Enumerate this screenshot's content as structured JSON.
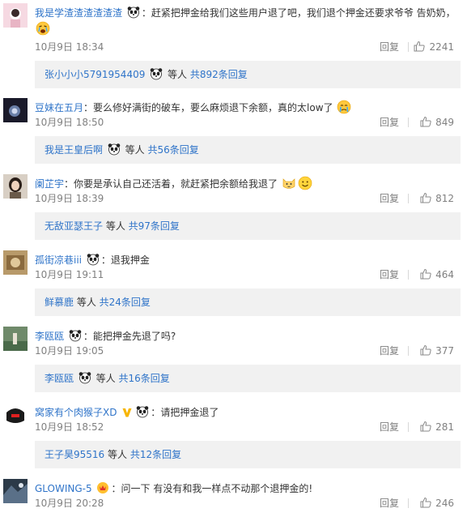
{
  "comments": [
    {
      "user": "我是学渣渣渣渣渣渣",
      "sep": "：",
      "text": "赶紧把押金给我们这些用户退了吧，我们退个押金还要求爷爷 告奶奶，",
      "time": "10月9日 18:34",
      "reply_label": "回复",
      "likes": "2241",
      "sub_user": "张小小小5791954409",
      "sub_mid": " 等人 ",
      "sub_count": "共892条回复"
    },
    {
      "user": "豆妹在五月",
      "sep": "：",
      "text": "要么修好满街的破车，要么麻烦退下余额，真的太low了",
      "time": "10月9日 18:50",
      "reply_label": "回复",
      "likes": "849",
      "sub_user": "我是王皇后啊",
      "sub_mid": " 等人 ",
      "sub_count": "共56条回复"
    },
    {
      "user": "阑芷宇",
      "sep": "：",
      "text": "你要是承认自己还活着，就赶紧把余额给我退了",
      "time": "10月9日 18:39",
      "reply_label": "回复",
      "likes": "812",
      "sub_user": "无敌亚瑟王子",
      "sub_mid": " 等人 ",
      "sub_count": "共97条回复"
    },
    {
      "user": "孤街凉巷iii",
      "sep": "：",
      "text": "退我押金",
      "time": "10月9日 19:11",
      "reply_label": "回复",
      "likes": "464",
      "sub_user": "鲜慕鹿",
      "sub_mid": " 等人 ",
      "sub_count": "共24条回复"
    },
    {
      "user": "李瓯瓯",
      "sep": "：",
      "text": "能把押金先退了吗?",
      "time": "10月9日 19:05",
      "reply_label": "回复",
      "likes": "377",
      "sub_user": "李瓯瓯",
      "sub_mid": " 等人 ",
      "sub_count": "共16条回复"
    },
    {
      "user": "窝家有个肉猴子XD",
      "sep": "：",
      "text": "请把押金退了",
      "time": "10月9日 18:52",
      "reply_label": "回复",
      "likes": "281",
      "sub_user": "王子昊95516",
      "sub_mid": " 等人 ",
      "sub_count": "共12条回复"
    },
    {
      "user": "GLOWING-5",
      "sep": "：",
      "text": "问一下 有没有和我一样点不动那个退押金的!",
      "time": "10月9日 20:28",
      "reply_label": "回复",
      "likes": "246"
    }
  ],
  "colors": {
    "link": "#2f74c9",
    "meta": "#808080",
    "sub_bg": "#f1f1f1"
  }
}
